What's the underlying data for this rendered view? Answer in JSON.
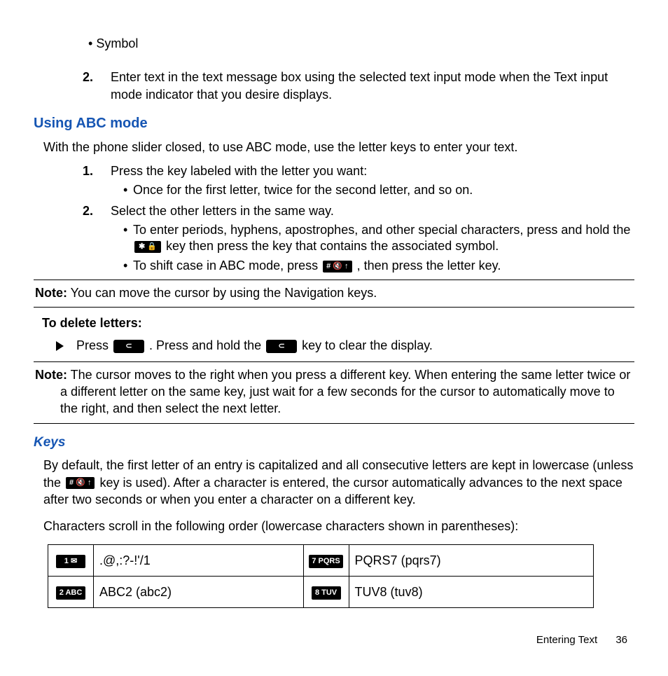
{
  "top_bullet": "Symbol",
  "top_step2_num": "2.",
  "top_step2_text": "Enter text in the text message box using the selected text input mode when the Text input mode indicator that you desire displays.",
  "h_abc": "Using ABC mode",
  "abc_intro": "With the phone slider closed, to use ABC mode, use the letter keys to enter your text.",
  "s1_num": "1.",
  "s1_text": "Press the key labeled with the letter you want:",
  "s1_sub1": "Once for the first letter, twice for the second letter, and so on.",
  "s2_num": "2.",
  "s2_text": "Select the other letters in the same way.",
  "s2_sub1_a": "To enter periods, hyphens, apostrophes, and other special characters, press and hold the ",
  "s2_sub1_key": "✱ 🔒",
  "s2_sub1_b": " key then press the key that contains the associated symbol.",
  "s2_sub2_a": "To shift case in ABC mode, press ",
  "s2_sub2_key": "# 🔇 ↑",
  "s2_sub2_b": " , then press the letter key.",
  "note1_label": "Note:",
  "note1_text": " You can move the cursor by using the Navigation keys.",
  "del_title": "To delete letters:",
  "del_a": "Press ",
  "del_key1": "⊂",
  "del_b": " . Press and hold the ",
  "del_key2": "⊂",
  "del_c": " key to clear the display.",
  "note2_label": "Note:",
  "note2_text": " The cursor moves to the right when you press a different key. When entering the same letter twice or a different letter on the same key, just wait for a few seconds for the cursor to automatically move to the right, and then select the next letter.",
  "h_keys": "Keys",
  "keys_p1_a": "By default, the first letter of an entry is capitalized and all consecutive letters are kept in lowercase (unless the ",
  "keys_p1_key": "# 🔇 ↑",
  "keys_p1_b": " key is used). After a character is entered, the cursor automatically advances to the next space after two seconds or when you enter a character on a different key.",
  "keys_p2": "Characters scroll in the following order (lowercase characters shown in parentheses):",
  "table": {
    "r1": {
      "k1": "1 ✉",
      "v1": ".@,:?-!'/1",
      "k2": "7 PQRS",
      "v2": "PQRS7 (pqrs7)"
    },
    "r2": {
      "k1": "2 ABC",
      "v1": "ABC2 (abc2)",
      "k2": "8 TUV",
      "v2": "TUV8 (tuv8)"
    }
  },
  "footer_section": "Entering Text",
  "footer_page": "36"
}
